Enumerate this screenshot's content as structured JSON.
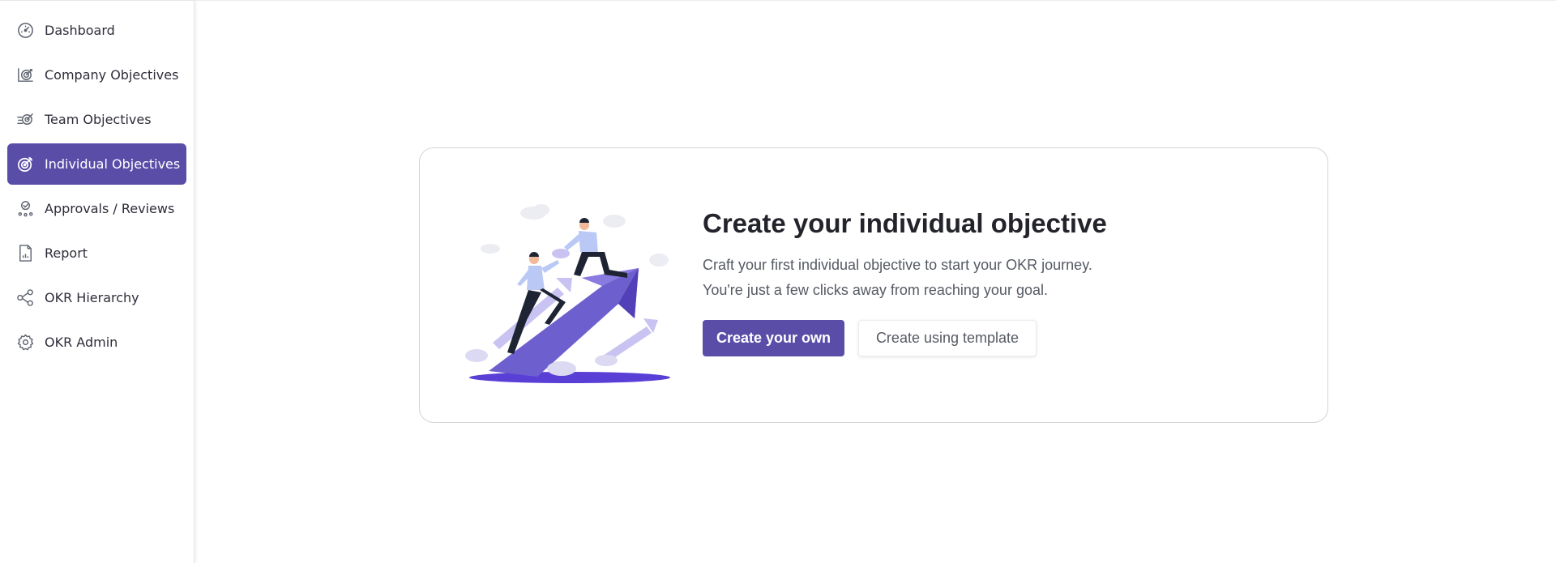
{
  "sidebar": {
    "items": [
      {
        "label": "Dashboard",
        "icon": "dashboard-gauge-icon",
        "active": false
      },
      {
        "label": "Company Objectives",
        "icon": "company-target-icon",
        "active": false
      },
      {
        "label": "Team Objectives",
        "icon": "team-target-icon",
        "active": false
      },
      {
        "label": "Individual Objectives",
        "icon": "individual-target-icon",
        "active": true
      },
      {
        "label": "Approvals / Reviews",
        "icon": "approvals-user-check-icon",
        "active": false
      },
      {
        "label": "Report",
        "icon": "report-document-icon",
        "active": false
      },
      {
        "label": "OKR Hierarchy",
        "icon": "hierarchy-nodes-icon",
        "active": false
      },
      {
        "label": "OKR Admin",
        "icon": "gear-icon",
        "active": false
      }
    ]
  },
  "main": {
    "title": "Create your individual objective",
    "description_line1": "Craft your first individual objective to start your OKR journey.",
    "description_line2": "You're just a few clicks away from reaching your goal.",
    "primary_button": "Create your own",
    "secondary_button": "Create using template"
  },
  "colors": {
    "accent": "#5a4da8",
    "illustration_purple": "#6e5fcf",
    "illustration_light": "#c9c3f2"
  }
}
